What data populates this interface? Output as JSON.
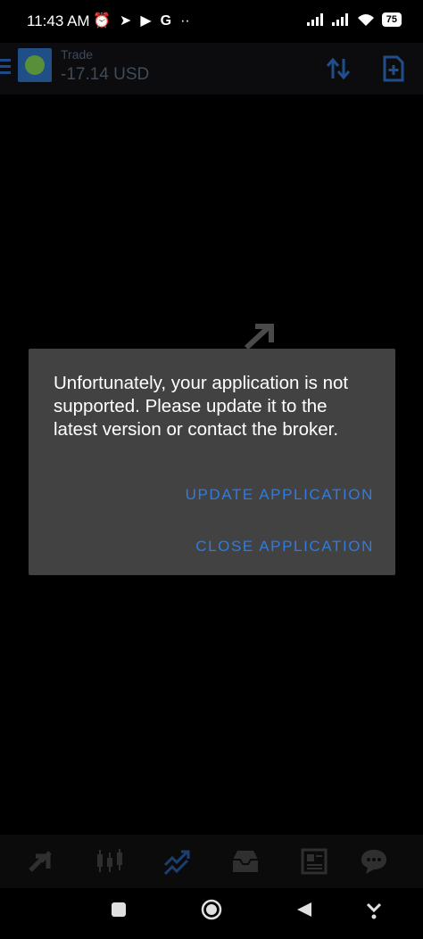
{
  "status_bar": {
    "time": "11:43 AM",
    "left_icons": [
      "alarm-icon",
      "telegram-icon",
      "play-icon",
      "google-icon",
      "more-icon"
    ],
    "right_icons": [
      "signal-icon",
      "signal-icon",
      "wifi-icon"
    ],
    "battery": "75"
  },
  "toolbar": {
    "title": "Trade",
    "subtitle": "-17.14 USD",
    "actions": [
      "sort-icon",
      "new-document-icon"
    ]
  },
  "dialog": {
    "message": "Unfortunately, your application is not supported. Please update it to the latest version or contact the broker.",
    "update_button": "UPDATE APPLICATION",
    "close_button": "CLOSE APPLICATION",
    "accent_color": "#2f7be0",
    "background_color": "#424242"
  },
  "bottom_nav": {
    "items": [
      "quotes-icon",
      "chart-icon",
      "trade-icon",
      "history-icon",
      "news-icon",
      "chat-icon"
    ],
    "active": "trade-icon"
  },
  "system_nav": [
    "recents-button",
    "home-button",
    "back-button",
    "keyboard-hide-button"
  ]
}
